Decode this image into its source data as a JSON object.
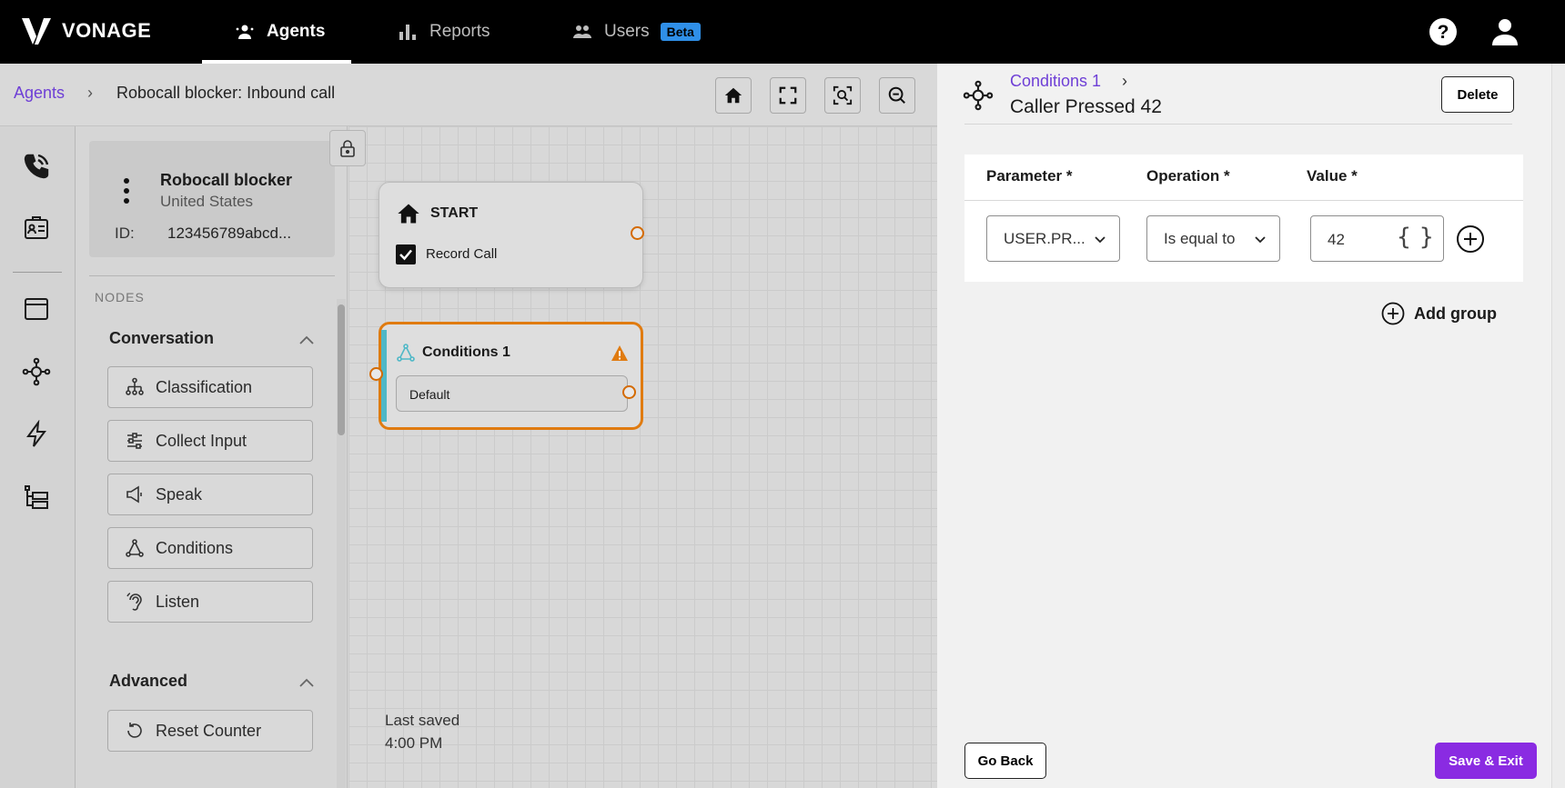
{
  "topnav": {
    "brand": "VONAGE",
    "tabs": [
      {
        "label": "Agents",
        "icon": "agents-icon",
        "active": true
      },
      {
        "label": "Reports",
        "icon": "bar-chart-icon",
        "active": false
      },
      {
        "label": "Users",
        "icon": "users-icon",
        "active": false,
        "badge": "Beta"
      }
    ],
    "icons": [
      "help-icon",
      "user-avatar-icon"
    ]
  },
  "breadcrumb": {
    "parent": "Agents",
    "separator": "›",
    "current": "Robocall blocker: Inbound call"
  },
  "toolbar": {
    "buttons": [
      "home-icon",
      "fit-screen-icon",
      "zoom-fit-icon",
      "zoom-out-icon"
    ]
  },
  "agent": {
    "name": "Robocall blocker",
    "country": "United States",
    "id_label": "ID:",
    "id": "123456789abcd..."
  },
  "nodes_panel": {
    "label": "NODES",
    "sections": [
      {
        "title": "Conversation",
        "items": [
          "Classification",
          "Collect Input",
          "Speak",
          "Conditions",
          "Listen"
        ]
      },
      {
        "title": "Advanced",
        "items": [
          "Reset Counter"
        ]
      }
    ]
  },
  "canvas": {
    "start": {
      "title": "START",
      "option": "Record Call",
      "checked": true
    },
    "conditions": {
      "title": "Conditions 1",
      "default_branch": "Default",
      "warning": true
    },
    "last_saved_label": "Last saved",
    "last_saved_time": "4:00 PM"
  },
  "drawer": {
    "breadcrumb": "Conditions 1",
    "separator": "›",
    "title": "Caller Pressed 42",
    "delete_label": "Delete",
    "columns": [
      "Parameter *",
      "Operation *",
      "Value *"
    ],
    "row": {
      "parameter": "USER.PR...",
      "operation": "Is equal to",
      "value": "42",
      "braces": "{ }"
    },
    "add_group_label": "Add group",
    "go_back_label": "Go Back",
    "save_exit_label": "Save & Exit"
  },
  "colors": {
    "accent": "#8a2be2",
    "link": "#6e3fd6",
    "warning": "#e07b10",
    "beta": "#2f8fe8"
  }
}
